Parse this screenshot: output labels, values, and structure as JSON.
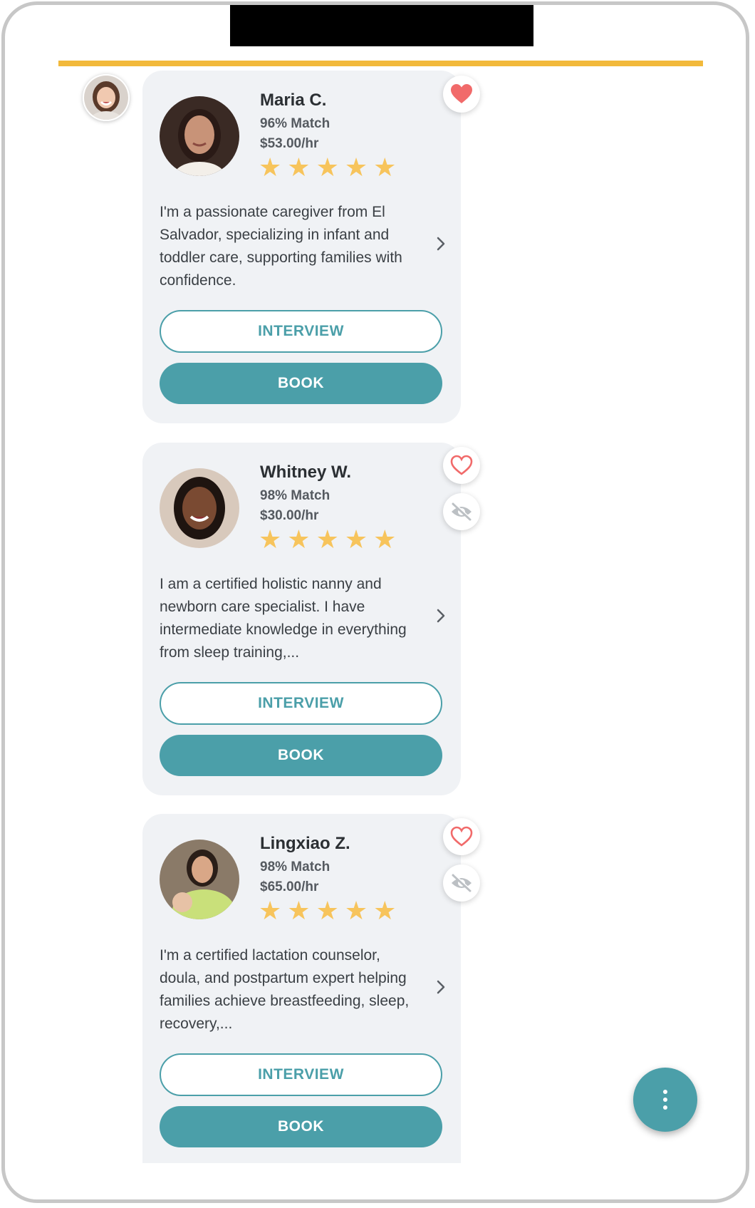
{
  "colors": {
    "accent_teal": "#4b9fa9",
    "divider_yellow": "#f2b93b",
    "heart_red": "#f16a6a",
    "star_gold": "#f7c45c",
    "card_bg": "#f0f2f5"
  },
  "host": {
    "avatar_icon": "user-avatar"
  },
  "caregivers": [
    {
      "name": "Maria C.",
      "match": "96% Match",
      "rate": "$53.00/hr",
      "rating": 5,
      "bio": "I'm a passionate caregiver from El Salvador, specializing in infant and toddler care, supporting families with confidence.",
      "favorited": true,
      "interview_label": "INTERVIEW",
      "book_label": "BOOK"
    },
    {
      "name": "Whitney W.",
      "match": "98% Match",
      "rate": "$30.00/hr",
      "rating": 5,
      "bio": "I am a certified holistic nanny and newborn care specialist. I have intermediate knowledge in everything from sleep training,...",
      "favorited": false,
      "interview_label": "INTERVIEW",
      "book_label": "BOOK"
    },
    {
      "name": "Lingxiao Z.",
      "match": "98% Match",
      "rate": "$65.00/hr",
      "rating": 5,
      "bio": "I'm a certified lactation counselor, doula, and postpartum expert helping families achieve breastfeeding, sleep, recovery,...",
      "favorited": false,
      "interview_label": "INTERVIEW",
      "book_label": "BOOK"
    }
  ],
  "fab": {
    "icon": "more-vertical-icon"
  }
}
